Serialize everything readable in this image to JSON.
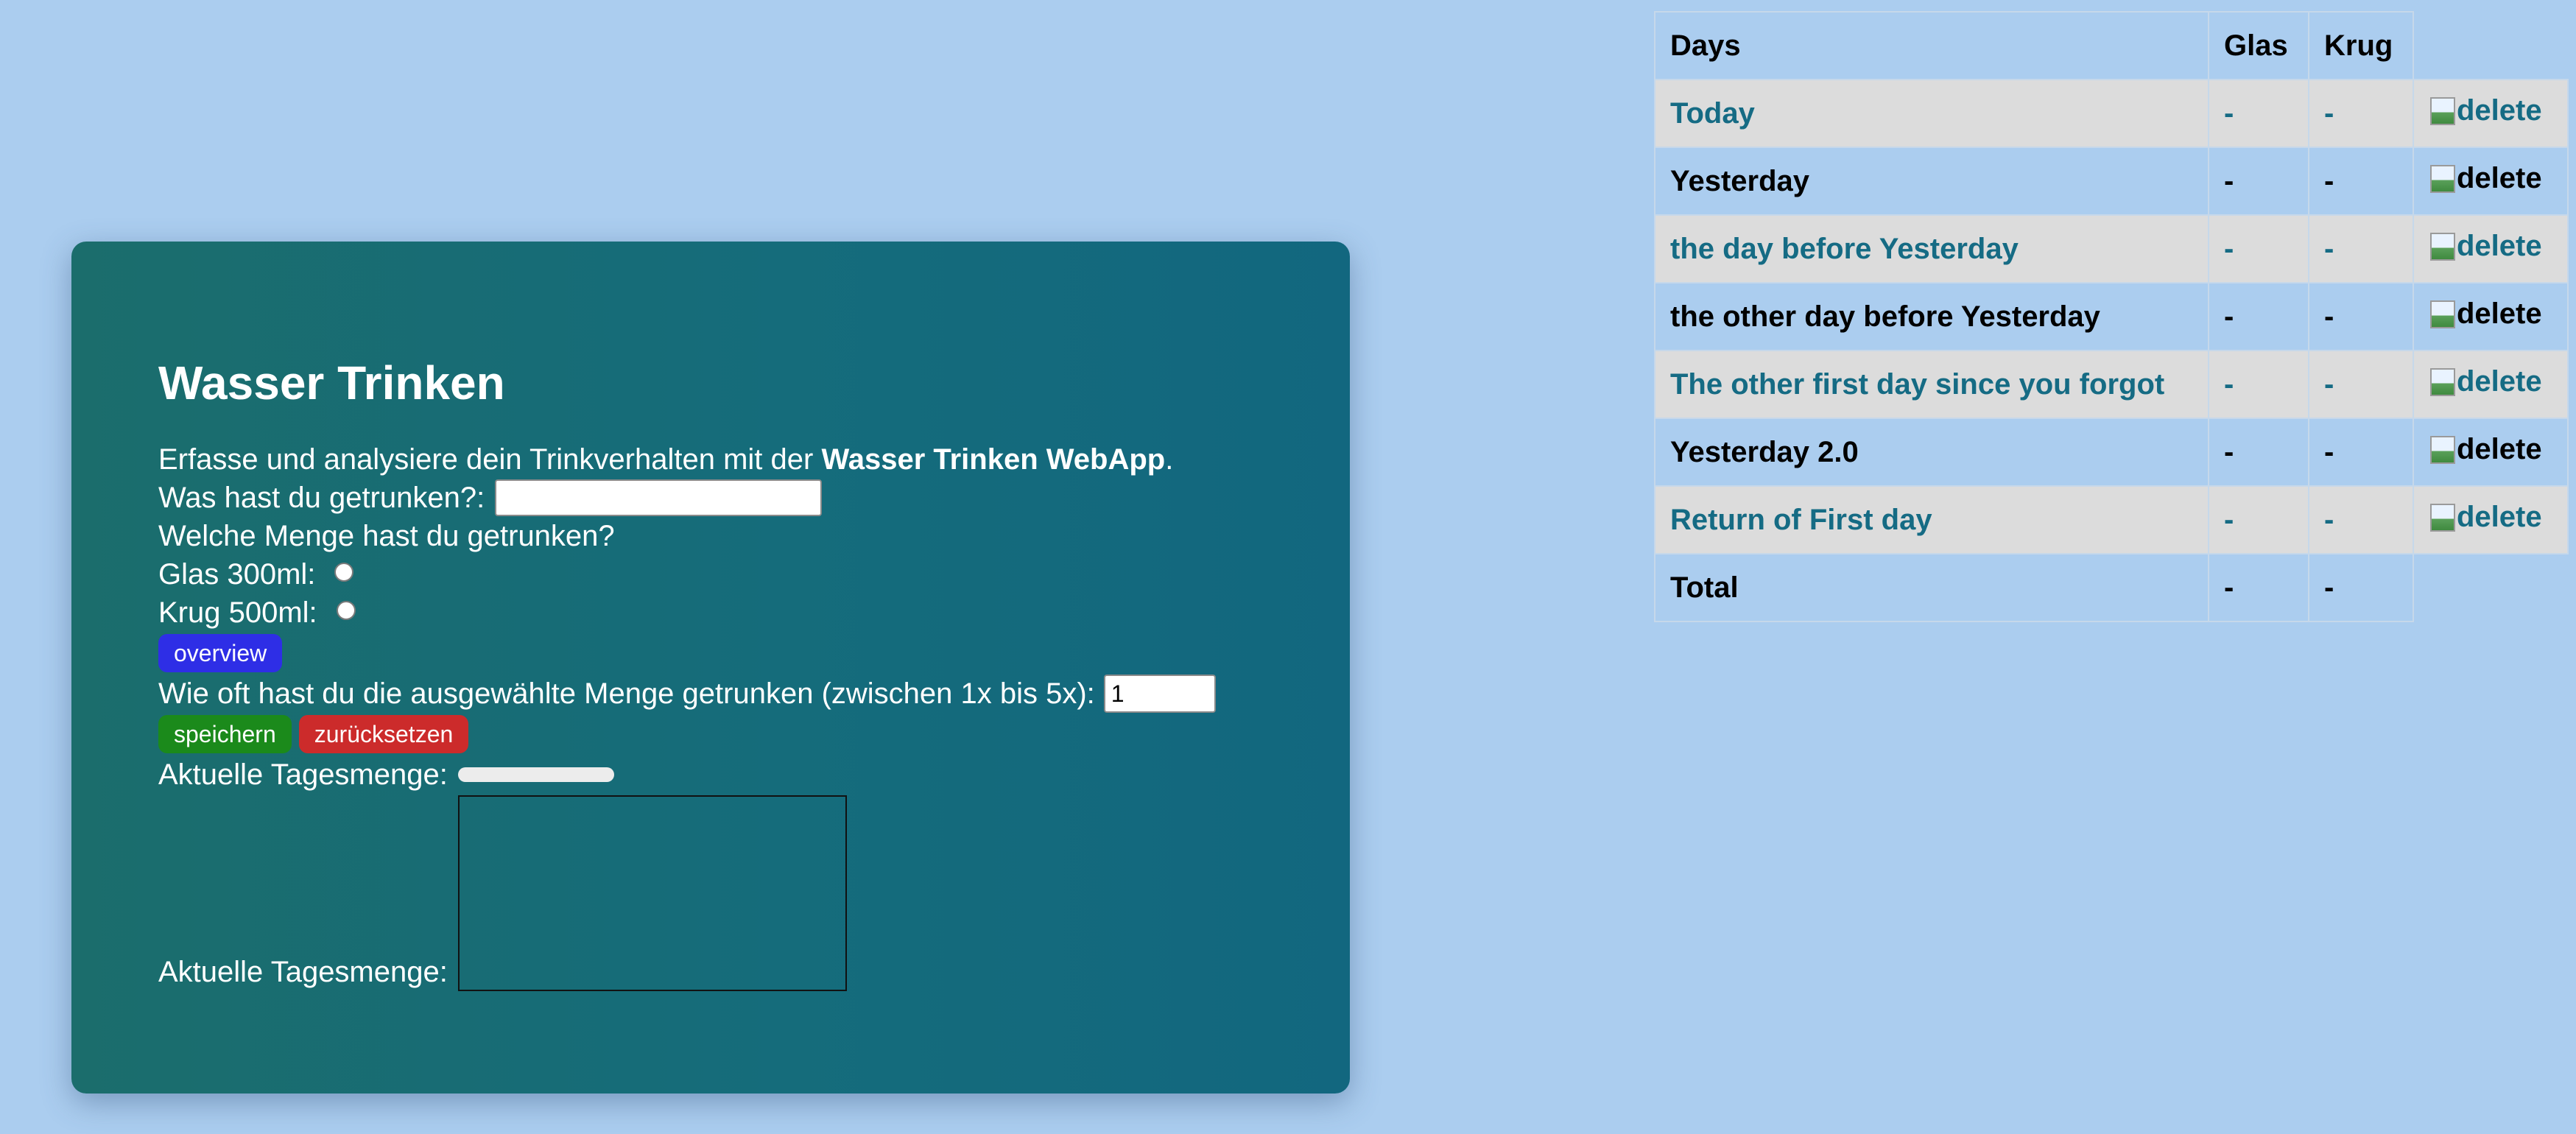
{
  "app": {
    "title": "Wasser Trinken",
    "intro_prefix": "Erfasse und analysiere dein Trinkverhalten mit der ",
    "intro_bold": "Wasser Trinken WebApp",
    "intro_suffix": ".",
    "drink_label": "Was hast du getrunken?:",
    "drink_value": "",
    "amount_question": "Welche Menge hast du getrunken?",
    "options": [
      {
        "label": "Glas 300ml:",
        "checked": false
      },
      {
        "label": "Krug 500ml:",
        "checked": false
      }
    ],
    "overview_button": "overview",
    "times_label": "Wie oft hast du die ausgewählte Menge getrunken (zwischen 1x bis 5x):",
    "times_value": "1",
    "save_button": "speichern",
    "reset_button": "zurücksetzen",
    "progress_label": "Aktuelle Tagesmenge:",
    "progress_value": 0,
    "chart_label": "Aktuelle Tagesmenge:"
  },
  "table": {
    "headers": [
      "Days",
      "Glas",
      "Krug"
    ],
    "delete_alt": "delete",
    "rows": [
      {
        "day": "Today",
        "glas": "-",
        "krug": "-"
      },
      {
        "day": "Yesterday",
        "glas": "-",
        "krug": "-"
      },
      {
        "day": "the day before Yesterday",
        "glas": "-",
        "krug": "-"
      },
      {
        "day": "the other day before Yesterday",
        "glas": "-",
        "krug": "-"
      },
      {
        "day": "The other first day since you forgot",
        "glas": "-",
        "krug": "-"
      },
      {
        "day": "Yesterday 2.0",
        "glas": "-",
        "krug": "-"
      },
      {
        "day": "Return of First day",
        "glas": "-",
        "krug": "-"
      }
    ],
    "total": {
      "label": "Total",
      "glas": "-",
      "krug": "-"
    }
  },
  "colors": {
    "background": "#abcdef",
    "card": "#156c7b",
    "overview_button": "#2e2ee6",
    "save_button": "#1b8a1b",
    "reset_button": "#cc2b2b",
    "row_link": "#156b84"
  }
}
